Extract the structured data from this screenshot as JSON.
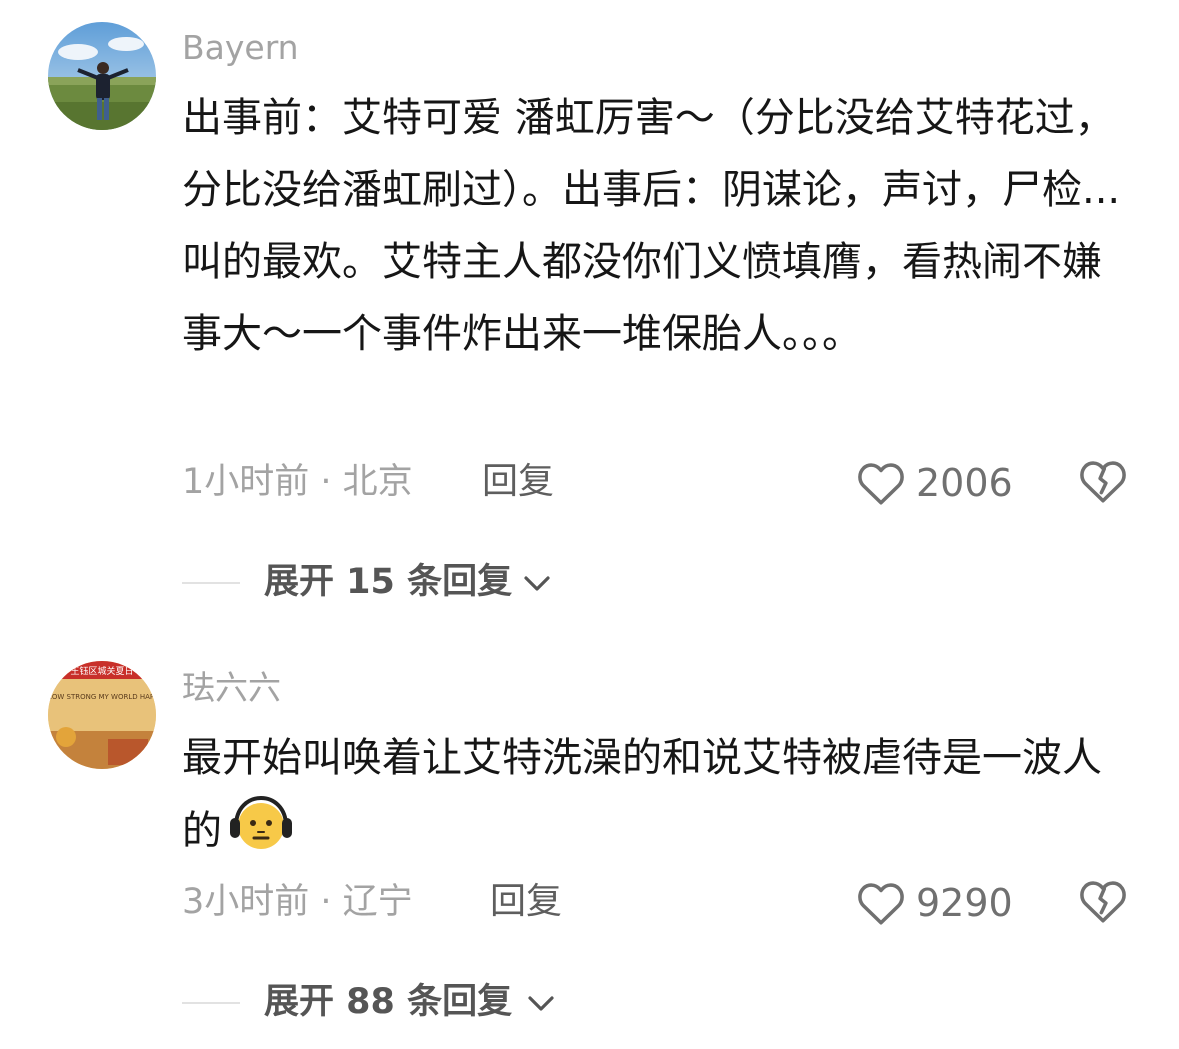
{
  "comments": [
    {
      "username": "Bayern",
      "text": "出事前：艾特可爱 潘虹厉害～（分比没给艾特花过，分比没给潘虹刷过）。出事后：阴谋论，声讨，尸检...叫的最欢。艾特主人都没你们义愤填膺，看热闹不嫌事大～一个事件炸出来一堆保胎人。。。",
      "time_location": "1小时前 · 北京",
      "reply_label": "回复",
      "likes": "2006",
      "expand_label": "展开 15 条回复"
    },
    {
      "username": "珐六六",
      "text": "最开始叫唤着让艾特洗澡的和说艾特被虐待是一波人的",
      "emoji": "headphones-face-emoji",
      "time_location": "3小时前 · 辽宁",
      "reply_label": "回复",
      "likes": "9290",
      "expand_label": "展开 88 条回复"
    }
  ],
  "icons": {
    "like": "heart-outline-icon",
    "dislike": "broken-heart-icon",
    "expand": "chevron-down-icon"
  },
  "colors": {
    "text_primary": "#161616",
    "text_secondary": "#a3a3a3",
    "reply": "#5e5e5e",
    "like_count": "#707070",
    "expand_label": "#555555",
    "emoji_face": "#f7c948"
  },
  "avatars": {
    "second_avatar_sign_text": "王钰区城关夏日",
    "second_avatar_wall_text": "GROW STRONG MY WORLD HAPPY"
  }
}
